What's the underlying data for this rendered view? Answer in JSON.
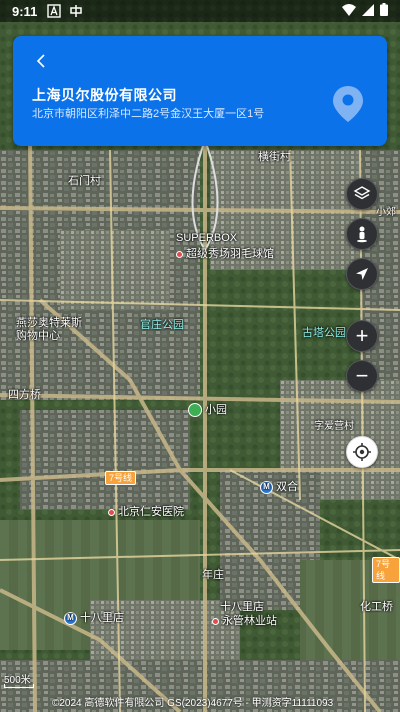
{
  "status_bar": {
    "time": "9:11",
    "icons_left": [
      "text-a-icon",
      "app-notification-icon"
    ],
    "icons_right": [
      "wifi-icon",
      "signal-icon",
      "battery-icon"
    ]
  },
  "header": {
    "title": "上海贝尔股份有限公司",
    "address": "北京市朝阳区利泽中二路2号金汉王大厦一区1号",
    "back_icon": "chevron-left-icon",
    "pin_icon": "location-pin-icon",
    "background_color": "#0b72ea"
  },
  "controls": {
    "layers_icon": "layers-icon",
    "street_view_icon": "person-icon",
    "navigate_icon": "navigation-arrow-icon",
    "zoom_in_label": "+",
    "zoom_out_label": "−",
    "my_location_icon": "crosshair-icon"
  },
  "map": {
    "labels": [
      {
        "text": "横街村"
      },
      {
        "text": "石门村"
      },
      {
        "text": "SUPERBOX"
      },
      {
        "text": "超级秀场羽毛球馆"
      },
      {
        "text": "官庄公园"
      },
      {
        "text": "古塔公园"
      },
      {
        "text": "燕莎奥特莱斯"
      },
      {
        "text": "购物中心"
      },
      {
        "text": "四方桥"
      },
      {
        "text": "小园"
      },
      {
        "text": "字爱营村"
      },
      {
        "text": "双合"
      },
      {
        "text": "北京仁安医院"
      },
      {
        "text": "年庄"
      },
      {
        "text": "十八里店"
      },
      {
        "text": "永管林业站"
      },
      {
        "text": "十八里店"
      },
      {
        "text": "化工桥"
      },
      {
        "text": "小郊"
      },
      {
        "text": "7号线"
      },
      {
        "text": "7号线"
      }
    ]
  },
  "footer": {
    "scale": "500米",
    "copyright": "©2024 高德软件有限公司 GS(2023)4677号 - 甲测资字11111093"
  }
}
